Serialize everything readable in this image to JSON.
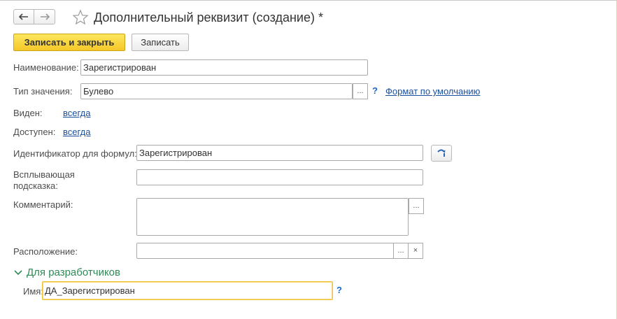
{
  "window": {
    "title": "Дополнительный реквизит (создание) *"
  },
  "toolbar": {
    "save_close_label": "Записать и закрыть",
    "save_label": "Записать"
  },
  "form": {
    "name": {
      "label": "Наименование:",
      "value": "Зарегистрирован"
    },
    "value_type": {
      "label": "Тип значения:",
      "value": "Булево",
      "select_btn": "...",
      "help": "?",
      "format_link": "Формат по умолчанию"
    },
    "visible": {
      "label": "Виден:",
      "value": "всегда"
    },
    "available": {
      "label": "Доступен:",
      "value": "всегда"
    },
    "formula_id": {
      "label": "Идентификатор для формул:",
      "value": "Зарегистрирован"
    },
    "tooltip": {
      "label": "Всплывающая подсказка:",
      "value": ""
    },
    "comment": {
      "label": "Комментарий:",
      "value": "",
      "select_btn": "..."
    },
    "location": {
      "label": "Расположение:",
      "value": "",
      "select_btn": "...",
      "clear_btn": "×"
    }
  },
  "developers": {
    "group_label": "Для разработчиков",
    "name": {
      "label": "Имя:",
      "value": "ДА_Зарегистрирован",
      "help": "?"
    }
  },
  "icons": {
    "back": "arrow-left-icon",
    "forward": "arrow-right-icon",
    "favorite": "star-icon",
    "refresh": "refresh-icon",
    "collapse": "chevron-down-icon"
  },
  "colors": {
    "accent_yellow": "#f5c829",
    "link": "#1a4f9c",
    "group": "#2e8b57",
    "focus": "#f0c238"
  }
}
